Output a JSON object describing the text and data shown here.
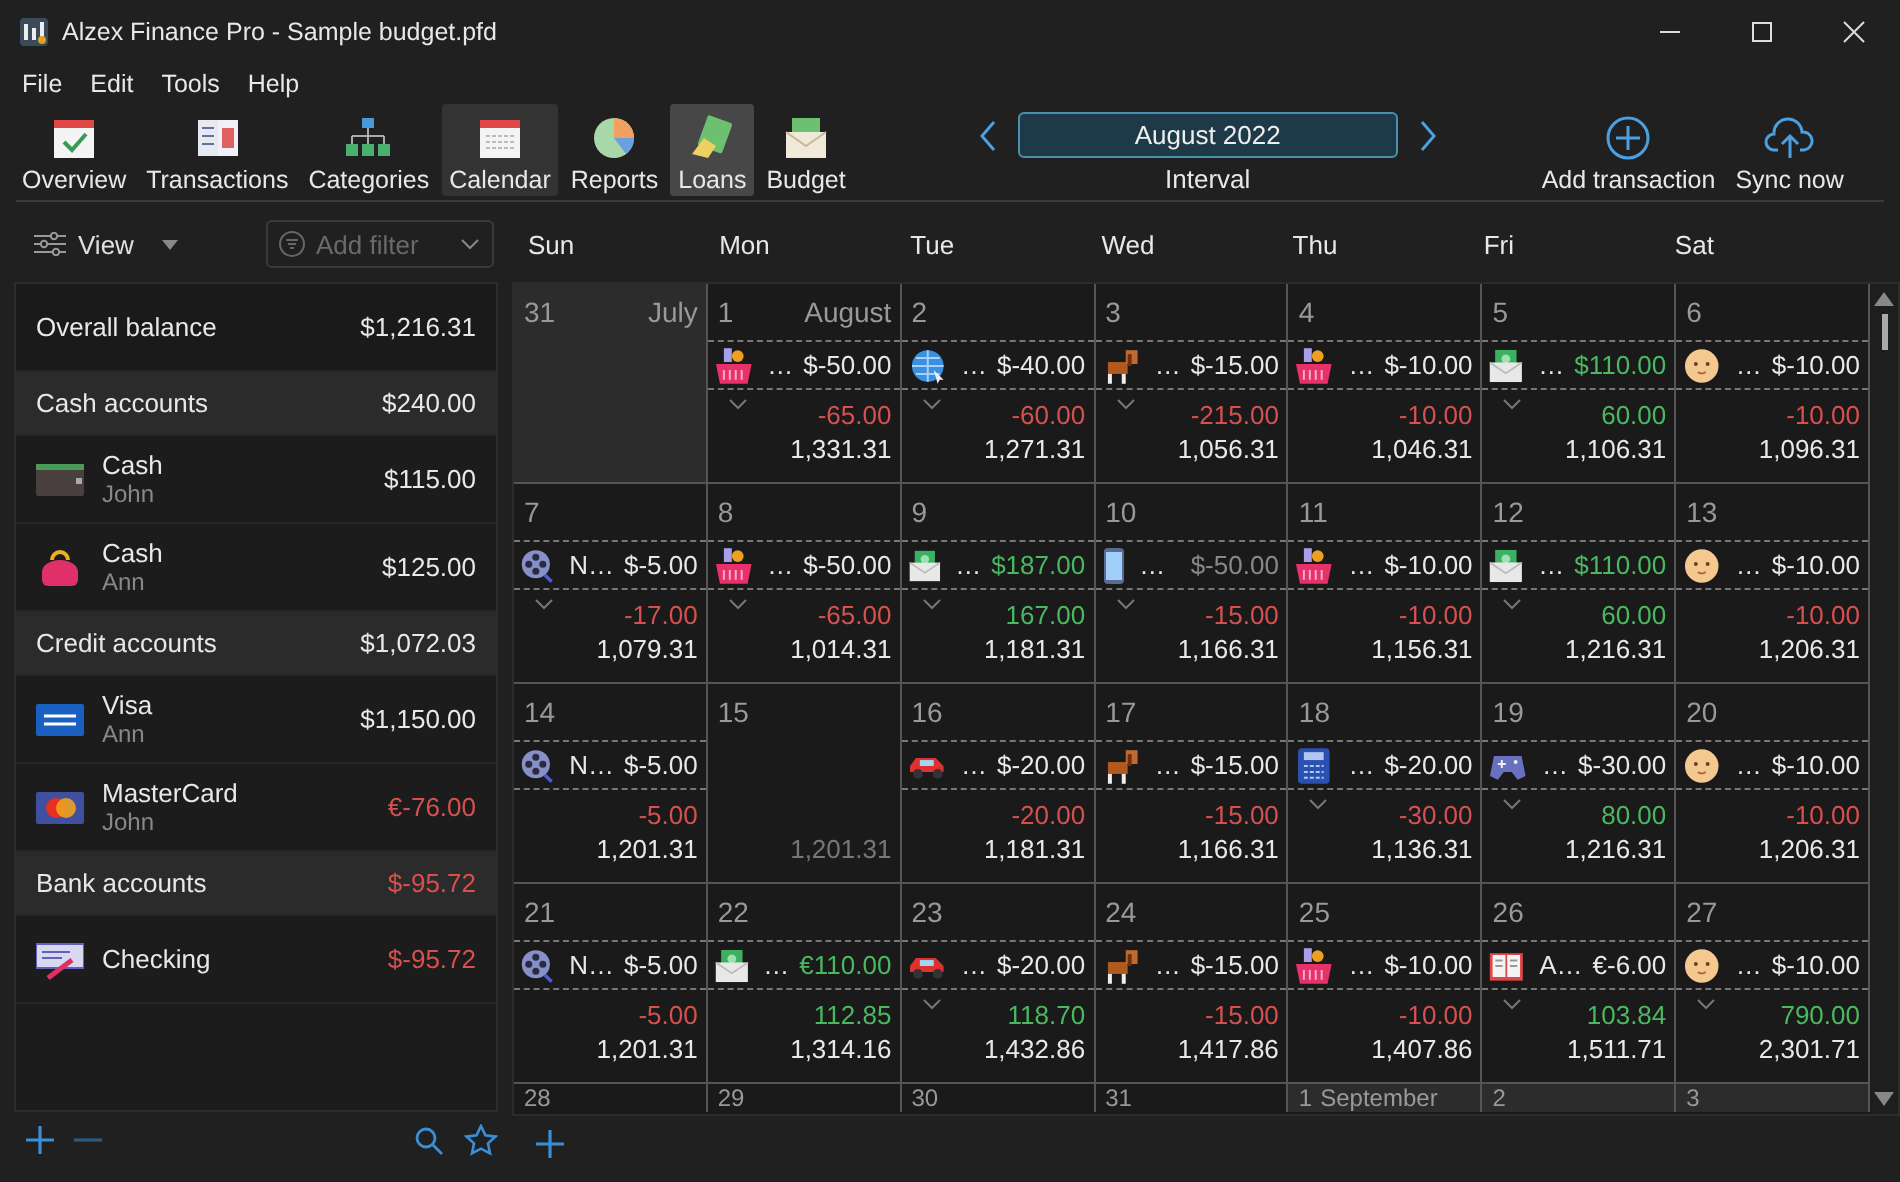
{
  "window": {
    "title": "Alzex Finance Pro - Sample budget.pfd"
  },
  "menu": [
    "File",
    "Edit",
    "Tools",
    "Help"
  ],
  "toolbar": [
    {
      "label": "Overview",
      "kind": "overview",
      "selected": false,
      "hovered": false
    },
    {
      "label": "Transactions",
      "kind": "transactions",
      "selected": false,
      "hovered": false
    },
    {
      "label": "Categories",
      "kind": "categories",
      "selected": false,
      "hovered": false
    },
    {
      "label": "Calendar",
      "kind": "calendar",
      "selected": true,
      "hovered": false
    },
    {
      "label": "Reports",
      "kind": "reports",
      "selected": false,
      "hovered": false
    },
    {
      "label": "Loans",
      "kind": "loans",
      "selected": false,
      "hovered": true
    },
    {
      "label": "Budget",
      "kind": "budget",
      "selected": false,
      "hovered": false
    }
  ],
  "interval": {
    "value": "August 2022",
    "label": "Interval"
  },
  "actions": [
    {
      "label": "Add transaction",
      "kind": "add"
    },
    {
      "label": "Sync now",
      "kind": "sync"
    }
  ],
  "view_button": "View",
  "filter": {
    "placeholder": "Add filter"
  },
  "accounts": [
    {
      "kind": "total",
      "name": "Overall balance",
      "amount": "$1,216.31",
      "negative": false
    },
    {
      "kind": "group",
      "name": "Cash accounts",
      "amount": "$240.00",
      "negative": false
    },
    {
      "kind": "wallet",
      "name": "Cash",
      "owner": "John",
      "amount": "$115.00",
      "negative": false
    },
    {
      "kind": "purse",
      "name": "Cash",
      "owner": "Ann",
      "amount": "$125.00",
      "negative": false
    },
    {
      "kind": "group",
      "name": "Credit accounts",
      "amount": "$1,072.03",
      "negative": false
    },
    {
      "kind": "visa",
      "name": "Visa",
      "owner": "Ann",
      "amount": "$1,150.00",
      "negative": false
    },
    {
      "kind": "mastercard",
      "name": "MasterCard",
      "owner": "John",
      "amount": "€-76.00",
      "negative": true
    },
    {
      "kind": "group",
      "name": "Bank accounts",
      "amount": "$-95.72",
      "negative": true
    },
    {
      "kind": "cheque",
      "name": "Checking",
      "amount": "$-95.72",
      "negative": true
    }
  ],
  "calendar": {
    "weekdays": [
      "Sun",
      "Mon",
      "Tue",
      "Wed",
      "Thu",
      "Fri",
      "Sat"
    ],
    "weeks": [
      [
        {
          "day": "31",
          "month": "July",
          "in_month": false
        },
        {
          "day": "1",
          "month": "August",
          "in_month": true,
          "tx": {
            "kind": "groceries",
            "desc": "…",
            "amount": "$-50.00",
            "income": false,
            "pending": false
          },
          "expandable": true,
          "total": "-65.00",
          "total_negative": true,
          "balance": "1,331.31",
          "balance_muted": false
        },
        {
          "day": "2",
          "in_month": true,
          "tx": {
            "kind": "globe",
            "desc": "…",
            "amount": "$-40.00",
            "income": false,
            "pending": false
          },
          "expandable": true,
          "total": "-60.00",
          "total_negative": true,
          "balance": "1,271.31",
          "balance_muted": false
        },
        {
          "day": "3",
          "in_month": true,
          "tx": {
            "kind": "dog",
            "desc": "…",
            "amount": "$-15.00",
            "income": false,
            "pending": false
          },
          "expandable": true,
          "total": "-215.00",
          "total_negative": true,
          "balance": "1,056.31",
          "balance_muted": false
        },
        {
          "day": "4",
          "in_month": true,
          "tx": {
            "kind": "groceries",
            "desc": "…",
            "amount": "$-10.00",
            "income": false,
            "pending": false
          },
          "expandable": false,
          "total": "-10.00",
          "total_negative": true,
          "balance": "1,046.31",
          "balance_muted": false
        },
        {
          "day": "5",
          "in_month": true,
          "tx": {
            "kind": "money",
            "desc": "…",
            "amount": "$110.00",
            "income": true,
            "pending": false
          },
          "expandable": true,
          "total": "60.00",
          "total_negative": false,
          "balance": "1,106.31",
          "balance_muted": false
        },
        {
          "day": "6",
          "in_month": true,
          "tx": {
            "kind": "baby",
            "desc": "…",
            "amount": "$-10.00",
            "income": false,
            "pending": false
          },
          "expandable": false,
          "total": "-10.00",
          "total_negative": true,
          "balance": "1,096.31",
          "balance_muted": false
        }
      ],
      [
        {
          "day": "7",
          "in_month": true,
          "tx": {
            "kind": "film",
            "desc": "N…",
            "amount": "$-5.00",
            "income": false,
            "pending": false
          },
          "expandable": true,
          "total": "-17.00",
          "total_negative": true,
          "balance": "1,079.31",
          "balance_muted": false
        },
        {
          "day": "8",
          "in_month": true,
          "tx": {
            "kind": "groceries",
            "desc": "…",
            "amount": "$-50.00",
            "income": false,
            "pending": false
          },
          "expandable": true,
          "total": "-65.00",
          "total_negative": true,
          "balance": "1,014.31",
          "balance_muted": false
        },
        {
          "day": "9",
          "in_month": true,
          "tx": {
            "kind": "money",
            "desc": "…",
            "amount": "$187.00",
            "income": true,
            "pending": false
          },
          "expandable": true,
          "total": "167.00",
          "total_negative": false,
          "balance": "1,181.31",
          "balance_muted": false
        },
        {
          "day": "10",
          "in_month": true,
          "tx": {
            "kind": "phone",
            "desc": "…",
            "amount": "$-50.00",
            "income": false,
            "pending": true
          },
          "expandable": true,
          "total": "-15.00",
          "total_negative": true,
          "balance": "1,166.31",
          "balance_muted": false
        },
        {
          "day": "11",
          "in_month": true,
          "tx": {
            "kind": "groceries",
            "desc": "…",
            "amount": "$-10.00",
            "income": false,
            "pending": false
          },
          "expandable": false,
          "total": "-10.00",
          "total_negative": true,
          "balance": "1,156.31",
          "balance_muted": false
        },
        {
          "day": "12",
          "in_month": true,
          "tx": {
            "kind": "money",
            "desc": "…",
            "amount": "$110.00",
            "income": true,
            "pending": false
          },
          "expandable": true,
          "total": "60.00",
          "total_negative": false,
          "balance": "1,216.31",
          "balance_muted": false
        },
        {
          "day": "13",
          "in_month": true,
          "tx": {
            "kind": "baby",
            "desc": "…",
            "amount": "$-10.00",
            "income": false,
            "pending": false
          },
          "expandable": false,
          "total": "-10.00",
          "total_negative": true,
          "balance": "1,206.31",
          "balance_muted": false
        }
      ],
      [
        {
          "day": "14",
          "in_month": true,
          "tx": {
            "kind": "film",
            "desc": "N…",
            "amount": "$-5.00",
            "income": false,
            "pending": false
          },
          "expandable": false,
          "total": "-5.00",
          "total_negative": true,
          "balance": "1,201.31",
          "balance_muted": false
        },
        {
          "day": "15",
          "in_month": true,
          "expandable": false,
          "balance": "1,201.31",
          "balance_muted": true
        },
        {
          "day": "16",
          "in_month": true,
          "tx": {
            "kind": "car",
            "desc": "…",
            "amount": "$-20.00",
            "income": false,
            "pending": false
          },
          "expandable": false,
          "total": "-20.00",
          "total_negative": true,
          "balance": "1,181.31",
          "balance_muted": false
        },
        {
          "day": "17",
          "in_month": true,
          "tx": {
            "kind": "dog",
            "desc": "…",
            "amount": "$-15.00",
            "income": false,
            "pending": false
          },
          "expandable": false,
          "total": "-15.00",
          "total_negative": true,
          "balance": "1,166.31",
          "balance_muted": false
        },
        {
          "day": "18",
          "in_month": true,
          "tx": {
            "kind": "fax",
            "desc": "…",
            "amount": "$-20.00",
            "income": false,
            "pending": false
          },
          "expandable": true,
          "total": "-30.00",
          "total_negative": true,
          "balance": "1,136.31",
          "balance_muted": false
        },
        {
          "day": "19",
          "in_month": true,
          "tx": {
            "kind": "gamepad",
            "desc": "…",
            "amount": "$-30.00",
            "income": false,
            "pending": false
          },
          "expandable": true,
          "total": "80.00",
          "total_negative": false,
          "balance": "1,216.31",
          "balance_muted": false
        },
        {
          "day": "20",
          "in_month": true,
          "tx": {
            "kind": "baby",
            "desc": "…",
            "amount": "$-10.00",
            "income": false,
            "pending": false
          },
          "expandable": false,
          "total": "-10.00",
          "total_negative": true,
          "balance": "1,206.31",
          "balance_muted": false
        }
      ],
      [
        {
          "day": "21",
          "in_month": true,
          "tx": {
            "kind": "film",
            "desc": "N…",
            "amount": "$-5.00",
            "income": false,
            "pending": false
          },
          "expandable": false,
          "total": "-5.00",
          "total_negative": true,
          "balance": "1,201.31",
          "balance_muted": false
        },
        {
          "day": "22",
          "in_month": true,
          "tx": {
            "kind": "money",
            "desc": "…",
            "amount": "€110.00",
            "income": true,
            "pending": false
          },
          "expandable": false,
          "total": "112.85",
          "total_negative": false,
          "balance": "1,314.16",
          "balance_muted": false
        },
        {
          "day": "23",
          "in_month": true,
          "tx": {
            "kind": "car",
            "desc": "…",
            "amount": "$-20.00",
            "income": false,
            "pending": false
          },
          "expandable": true,
          "total": "118.70",
          "total_negative": false,
          "balance": "1,432.86",
          "balance_muted": false
        },
        {
          "day": "24",
          "in_month": true,
          "tx": {
            "kind": "dog",
            "desc": "…",
            "amount": "$-15.00",
            "income": false,
            "pending": false
          },
          "expandable": false,
          "total": "-15.00",
          "total_negative": true,
          "balance": "1,417.86",
          "balance_muted": false
        },
        {
          "day": "25",
          "in_month": true,
          "tx": {
            "kind": "groceries",
            "desc": "…",
            "amount": "$-10.00",
            "income": false,
            "pending": false
          },
          "expandable": false,
          "total": "-10.00",
          "total_negative": true,
          "balance": "1,407.86",
          "balance_muted": false
        },
        {
          "day": "26",
          "in_month": true,
          "tx": {
            "kind": "book",
            "desc": "A…",
            "amount": "€-6.00",
            "income": false,
            "pending": false
          },
          "expandable": true,
          "total": "103.84",
          "total_negative": false,
          "balance": "1,511.71",
          "balance_muted": false
        },
        {
          "day": "27",
          "in_month": true,
          "tx": {
            "kind": "baby",
            "desc": "…",
            "amount": "$-10.00",
            "income": false,
            "pending": false
          },
          "expandable": true,
          "total": "790.00",
          "total_negative": false,
          "balance": "2,301.71",
          "balance_muted": false
        }
      ],
      [
        {
          "day": "28",
          "in_month": true
        },
        {
          "day": "29",
          "in_month": true
        },
        {
          "day": "30",
          "in_month": true
        },
        {
          "day": "31",
          "in_month": true
        },
        {
          "day": "1",
          "month": "September",
          "in_month": false
        },
        {
          "day": "2",
          "in_month": false
        },
        {
          "day": "3",
          "in_month": false
        }
      ]
    ]
  }
}
